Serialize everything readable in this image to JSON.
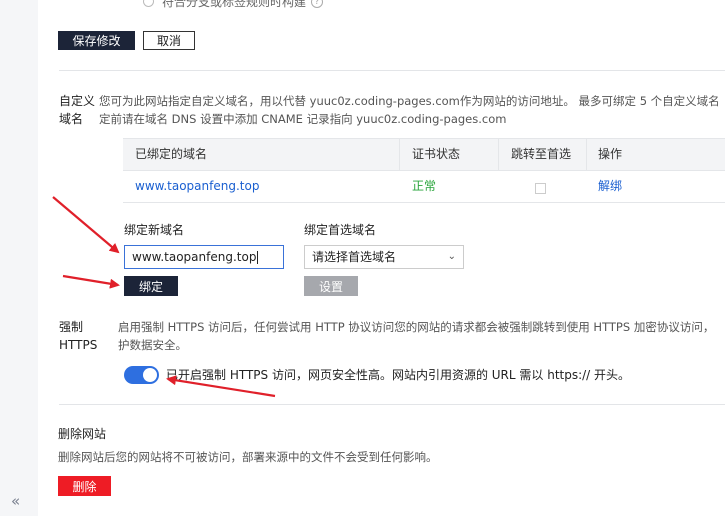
{
  "top_option": {
    "label": "符合分支或标签规则时构建"
  },
  "actions": {
    "save_label": "保存修改",
    "cancel_label": "取消"
  },
  "custom_domain": {
    "label_line1": "自定义",
    "label_line2": "域名",
    "desc_line1": "您可为此网站指定自定义域名，用以代替 yuuc0z.coding-pages.com作为网站的访问地址。 最多可绑定 5 个自定义域名",
    "desc_line2": "定前请在域名 DNS 设置中添加 CNAME 记录指向 yuuc0z.coding-pages.com",
    "table": {
      "headers": [
        "已绑定的域名",
        "证书状态",
        "跳转至首选",
        "操作"
      ],
      "rows": [
        {
          "domain": "www.taopanfeng.top",
          "cert_status": "正常",
          "redirect_checked": false,
          "action": "解绑"
        }
      ]
    },
    "bind_new_label": "绑定新域名",
    "bind_new_value": "www.taopanfeng.top",
    "bind_button": "绑定",
    "preferred_label": "绑定首选域名",
    "preferred_select": "请选择首选域名",
    "set_button": "设置"
  },
  "https": {
    "label_line1": "强制",
    "label_line2": "HTTPS",
    "desc_line1": "启用强制 HTTPS 访问后，任何尝试用 HTTP 协议访问您的网站的请求都会被强制跳转到使用 HTTPS 加密协议访问，",
    "desc_line2": "护数据安全。",
    "toggle_on": true,
    "toggle_text": "已开启强制 HTTPS 访问，网页安全性高。网站内引用资源的 URL 需以 https:// 开头。"
  },
  "delete_site": {
    "title": "删除网站",
    "desc": "删除网站后您的网站将不可被访问，部署来源中的文件不会受到任何影响。",
    "button": "删除"
  },
  "sidebar": {
    "collapse_glyph": "«"
  },
  "colors": {
    "primary_dark": "#1c2438",
    "link_blue": "#1a5fd0",
    "success_green": "#2aa53c",
    "danger_red": "#ee1c25",
    "toggle_blue": "#2e6fe0",
    "annotation_red": "#e0202a"
  }
}
